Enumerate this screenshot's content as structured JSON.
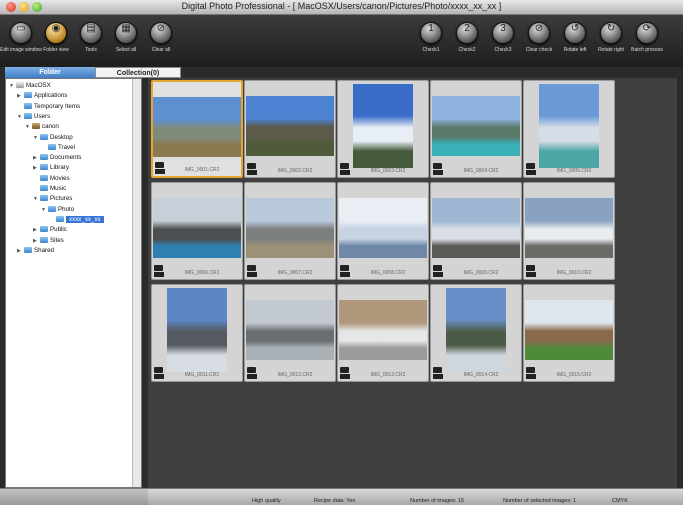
{
  "window": {
    "title": "Digital Photo Professional - [ MacOSX/Users/canon/Pictures/Photo/xxxx_xx_xx ]"
  },
  "toolbar": {
    "left": [
      {
        "label": "Edit image window",
        "icon": "edit-image-icon"
      },
      {
        "label": "Folder view",
        "icon": "folder-view-icon"
      },
      {
        "label": "Tools",
        "icon": "tools-icon"
      },
      {
        "label": "Select all",
        "icon": "select-all-icon"
      },
      {
        "label": "Clear all",
        "icon": "clear-all-icon"
      }
    ],
    "right": [
      {
        "label": "Check1",
        "icon": "check1-icon"
      },
      {
        "label": "Check2",
        "icon": "check2-icon"
      },
      {
        "label": "Check3",
        "icon": "check3-icon"
      },
      {
        "label": "Clear check",
        "icon": "clear-check-icon"
      },
      {
        "label": "Rotate left",
        "icon": "rotate-left-icon"
      },
      {
        "label": "Rotate right",
        "icon": "rotate-right-icon"
      },
      {
        "label": "Batch process",
        "icon": "batch-process-icon"
      }
    ]
  },
  "tabs": {
    "folder": "Folder",
    "collection": "Collection(0)"
  },
  "tree": [
    {
      "label": "MacOSX",
      "depth": 0,
      "expanded": true
    },
    {
      "label": "Applications",
      "depth": 1,
      "expanded": false
    },
    {
      "label": "Temporary Items",
      "depth": 1,
      "expanded": null
    },
    {
      "label": "Users",
      "depth": 1,
      "expanded": true
    },
    {
      "label": "canon",
      "depth": 2,
      "expanded": true
    },
    {
      "label": "Desktop",
      "depth": 3,
      "expanded": true
    },
    {
      "label": "Travel",
      "depth": 4,
      "expanded": null
    },
    {
      "label": "Documents",
      "depth": 3,
      "expanded": false
    },
    {
      "label": "Library",
      "depth": 3,
      "expanded": false
    },
    {
      "label": "Movies",
      "depth": 3,
      "expanded": null
    },
    {
      "label": "Music",
      "depth": 3,
      "expanded": null
    },
    {
      "label": "Pictures",
      "depth": 3,
      "expanded": true
    },
    {
      "label": "Photo",
      "depth": 4,
      "expanded": true
    },
    {
      "label": "xxxx_xx_xx",
      "depth": 5,
      "expanded": null,
      "selected": true
    },
    {
      "label": "Public",
      "depth": 3,
      "expanded": false
    },
    {
      "label": "Sites",
      "depth": 3,
      "expanded": false
    },
    {
      "label": "Shared",
      "depth": 1,
      "expanded": false
    }
  ],
  "thumbnails": [
    {
      "name": "IMG_0001.CR2",
      "orientation": "landscape",
      "sky": "#5e8fd0",
      "mid": "#7f8a7a",
      "ground": "#8b7a4f",
      "selected": true
    },
    {
      "name": "IMG_0002.CR2",
      "orientation": "landscape",
      "sky": "#4b82d1",
      "mid": "#5e5a4a",
      "ground": "#4f5a3b"
    },
    {
      "name": "IMG_0003.CR2",
      "orientation": "portrait",
      "sky": "#3a6dc8",
      "mid": "#e8eef5",
      "ground": "#445a3a"
    },
    {
      "name": "IMG_0004.CR2",
      "orientation": "landscape",
      "sky": "#8fb3e0",
      "mid": "#5a7a6a",
      "ground": "#39b0b5"
    },
    {
      "name": "IMG_0005.CR2",
      "orientation": "portrait",
      "sky": "#6b9ad8",
      "mid": "#d7dde6",
      "ground": "#4da7a6"
    },
    {
      "name": "IMG_0006.CR2",
      "orientation": "landscape",
      "sky": "#c7cfd9",
      "mid": "#4b4f4f",
      "ground": "#2f7fb3"
    },
    {
      "name": "IMG_0007.CR2",
      "orientation": "landscape",
      "sky": "#b9c9dc",
      "mid": "#7c7f80",
      "ground": "#9a9178"
    },
    {
      "name": "IMG_0008.CR2",
      "orientation": "landscape",
      "sky": "#e9eef4",
      "mid": "#c5d3e3",
      "ground": "#6f88a8"
    },
    {
      "name": "IMG_0009.CR2",
      "orientation": "landscape",
      "sky": "#9fb6d3",
      "mid": "#d9dfe5",
      "ground": "#5a5a55"
    },
    {
      "name": "IMG_0010.CR2",
      "orientation": "landscape",
      "sky": "#8aa2c2",
      "mid": "#e8ecef",
      "ground": "#6a6a66"
    },
    {
      "name": "IMG_0011.CR2",
      "orientation": "portrait",
      "sky": "#5c87c7",
      "mid": "#555a60",
      "ground": "#d7dde3"
    },
    {
      "name": "IMG_0012.CR2",
      "orientation": "landscape",
      "sky": "#c2c9d0",
      "mid": "#6b6e70",
      "ground": "#a9b0b6"
    },
    {
      "name": "IMG_0013.CR2",
      "orientation": "landscape",
      "sky": "#b1987c",
      "mid": "#e6e6e6",
      "ground": "#9c9c9c"
    },
    {
      "name": "IMG_0014.CR2",
      "orientation": "portrait",
      "sky": "#6a8fc8",
      "mid": "#4c5b46",
      "ground": "#cfd7de"
    },
    {
      "name": "IMG_0015.CR2",
      "orientation": "landscape",
      "sky": "#dfe6ee",
      "mid": "#8a6a4a",
      "ground": "#4f8a3a"
    }
  ],
  "status": {
    "quality": "High quality",
    "recipe": "Recipe data: Yes",
    "count": "Number of images: 15",
    "selected": "Number of selected images: 1",
    "cmyk": "CMYK"
  }
}
